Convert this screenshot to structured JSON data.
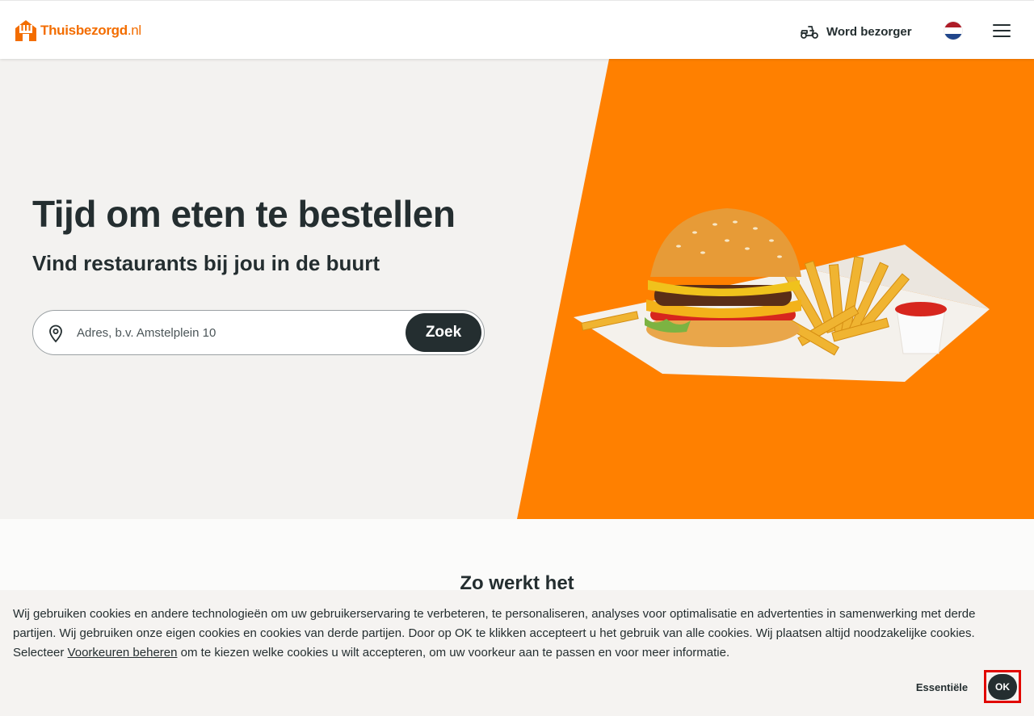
{
  "header": {
    "logo_text": "Thuisbezorgd",
    "logo_tld": ".nl",
    "courier_label": "Word bezorger",
    "language": "NL"
  },
  "hero": {
    "title": "Tijd om eten te bestellen",
    "subtitle": "Vind restaurants bij jou in de buurt",
    "search_placeholder": "Adres, b.v. Amstelplein 10",
    "search_value": "",
    "search_button": "Zoek"
  },
  "section": {
    "title": "Zo werkt het"
  },
  "cookie": {
    "text_before": "Wij gebruiken cookies en andere technologieën om uw gebruikerservaring te verbeteren, te personaliseren, analyses voor optimalisatie en advertenties in samenwerking met derde partijen. Wij gebruiken onze eigen cookies en cookies van derde partijen. Door op OK te klikken accepteert u het gebruik van alle cookies. Wij plaatsen altijd noodzakelijke cookies. Selecteer ",
    "link_label": "Voorkeuren beheren",
    "text_after": " om te kiezen welke cookies u wilt accepteren, om uw voorkeur aan te passen en voor meer informatie.",
    "essential_button": "Essentiële",
    "ok_button": "OK"
  },
  "colors": {
    "brand_orange": "#ff8000",
    "dark": "#242e30",
    "highlight_frame": "#e10600"
  },
  "icons": {
    "logo": "house-fork-logo-icon",
    "courier": "scooter-icon",
    "language": "netherlands-flag-icon",
    "menu": "hamburger-menu-icon",
    "search": "location-pin-icon"
  }
}
